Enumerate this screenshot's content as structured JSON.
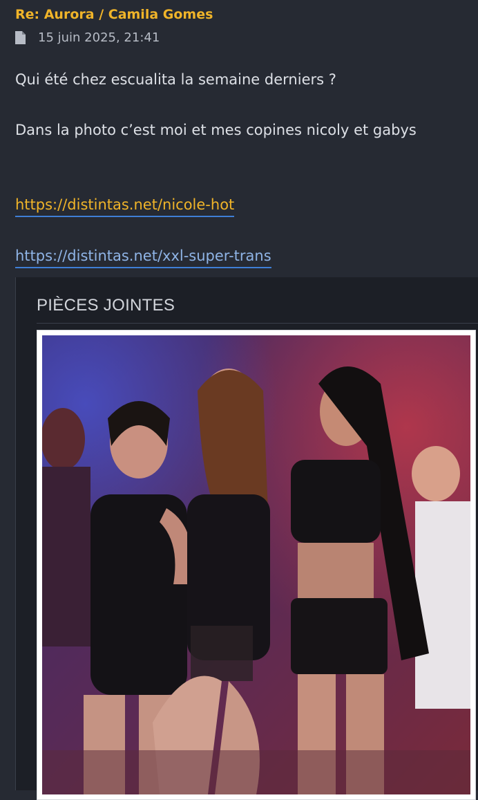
{
  "post": {
    "title": "Re: Aurora / Camila Gomes",
    "date": "15 juin 2025, 21:41",
    "date_icon": "document-icon",
    "body_line_1": "Qui été chez escualita la semaine derniers ?",
    "body_line_2": "Dans la photo c’est moi et mes copines nicoly et gabys",
    "link_1": "https://distintas.net/nicole-hot",
    "link_2": "https://distintas.net/xxl-super-trans"
  },
  "attachments": {
    "header": "PIÈCES JOINTES",
    "image_alt": "party photo"
  },
  "colors": {
    "background": "#262a33",
    "title": "#f0b429",
    "link_primary": "#f0b429",
    "link_secondary": "#8fb4e6",
    "underline": "#3f7fd6",
    "attachment_panel": "#1c1f26"
  }
}
